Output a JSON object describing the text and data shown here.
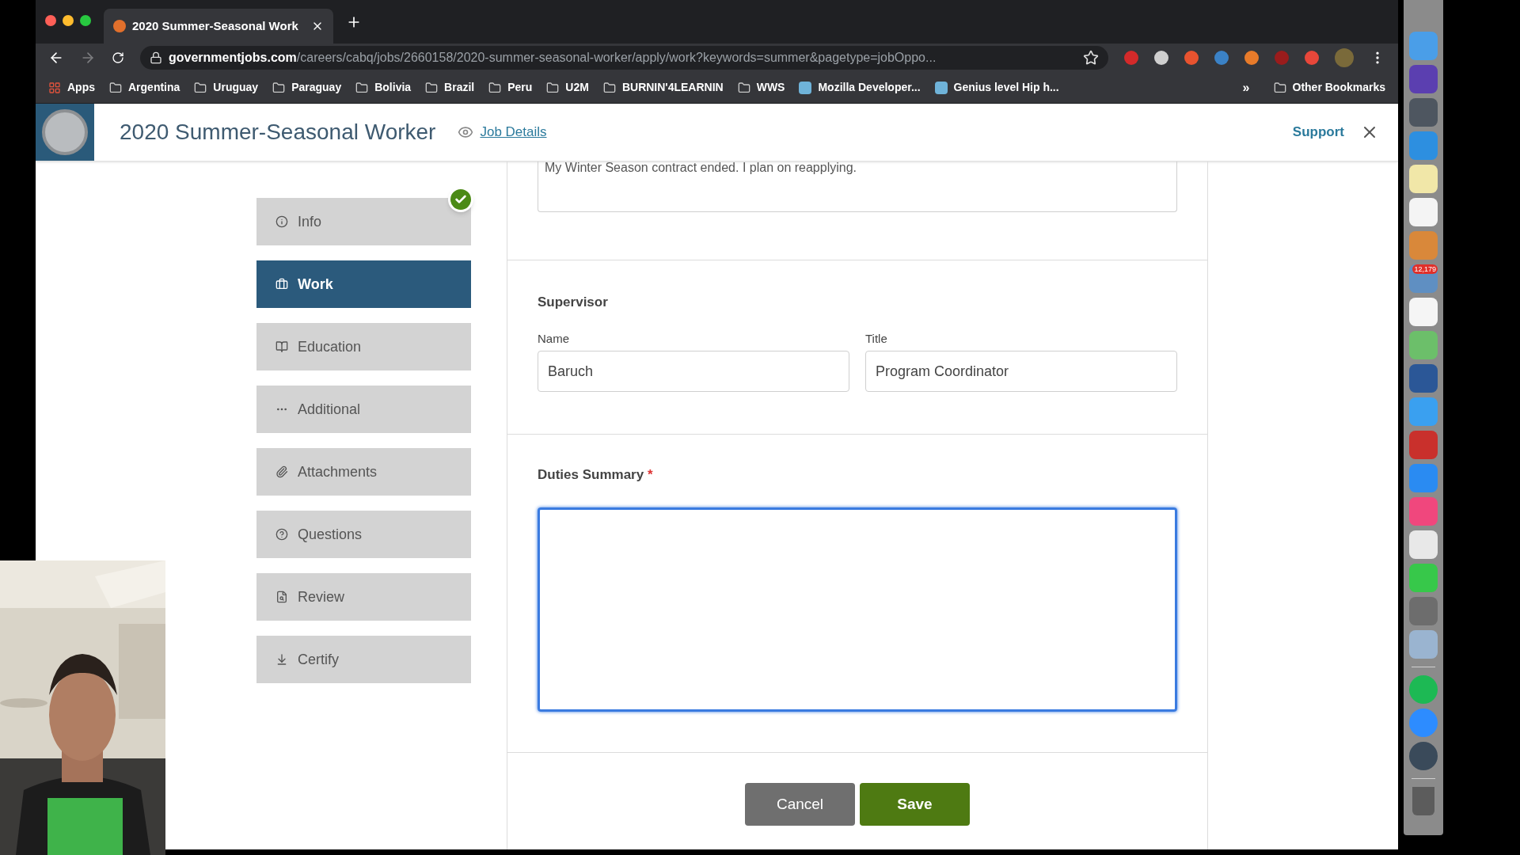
{
  "browser": {
    "tab": {
      "title": "2020 Summer-Seasonal Work",
      "selected": true
    },
    "url_host": "governmentjobs.com",
    "url_path": "/careers/cabq/jobs/2660158/2020-summer-seasonal-worker/apply/work?keywords=summer&pagetype=jobOppo...",
    "bookmarks": [
      {
        "kind": "apps",
        "label": "Apps"
      },
      {
        "kind": "folder",
        "label": "Argentina"
      },
      {
        "kind": "folder",
        "label": "Uruguay"
      },
      {
        "kind": "folder",
        "label": "Paraguay"
      },
      {
        "kind": "folder",
        "label": "Bolivia"
      },
      {
        "kind": "folder",
        "label": "Brazil"
      },
      {
        "kind": "folder",
        "label": "Peru"
      },
      {
        "kind": "folder",
        "label": "U2M"
      },
      {
        "kind": "folder",
        "label": "BURNIN'4LEARNIN"
      },
      {
        "kind": "folder",
        "label": "WWS"
      },
      {
        "kind": "page",
        "label": "Mozilla Developer..."
      },
      {
        "kind": "page",
        "label": "Genius level Hip h..."
      }
    ],
    "more": "»",
    "other_bookmarks": "Other Bookmarks"
  },
  "header": {
    "title": "2020 Summer-Seasonal Worker",
    "job_details": "Job Details",
    "support": "Support"
  },
  "steps": [
    {
      "kind": "info",
      "label": "Info",
      "selected": false,
      "completed": true
    },
    {
      "kind": "work",
      "label": "Work",
      "selected": true,
      "completed": false
    },
    {
      "kind": "education",
      "label": "Education",
      "selected": false,
      "completed": false
    },
    {
      "kind": "additional",
      "label": "Additional",
      "selected": false,
      "completed": false
    },
    {
      "kind": "attachments",
      "label": "Attachments",
      "selected": false,
      "completed": false
    },
    {
      "kind": "questions",
      "label": "Questions",
      "selected": false,
      "completed": false
    },
    {
      "kind": "review",
      "label": "Review",
      "selected": false,
      "completed": false
    },
    {
      "kind": "certify",
      "label": "Certify",
      "selected": false,
      "completed": false
    }
  ],
  "form": {
    "reason_value": "My Winter Season contract ended. I plan on reapplying.",
    "supervisor": {
      "heading": "Supervisor",
      "name_label": "Name",
      "name_value": "Baruch",
      "title_label": "Title",
      "title_value": "Program Coordinator"
    },
    "duties": {
      "label": "Duties Summary",
      "required": "*",
      "focused": true
    },
    "buttons": {
      "cancel": "Cancel",
      "save": "Save"
    }
  },
  "dock": {
    "badge": "12,179"
  }
}
